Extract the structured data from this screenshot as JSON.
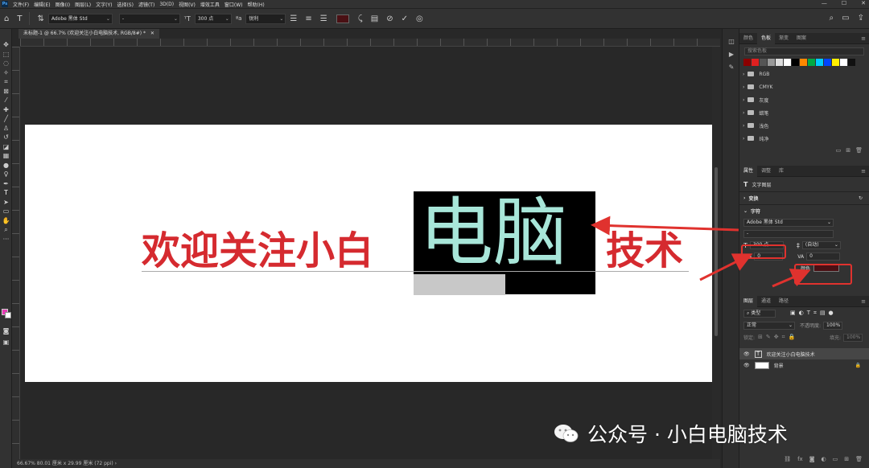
{
  "menubar": {
    "logo": "Ps",
    "items": [
      "文件(F)",
      "编辑(E)",
      "图像(I)",
      "图层(L)",
      "文字(Y)",
      "选择(S)",
      "滤镜(T)",
      "3D(D)",
      "视图(V)",
      "增效工具",
      "窗口(W)",
      "帮助(H)"
    ],
    "window_controls": [
      "—",
      "☐",
      "✕"
    ]
  },
  "options": {
    "font_family": "Adobe 黑体 Std",
    "font_style": "-",
    "font_size": "300 点",
    "anti_alias": "锐利",
    "text_color": "#4a1014"
  },
  "document": {
    "tab_title": "未标题-1 @ 66.7% (欢迎关注小白电脑技术, RGB/8#) *",
    "text_before": "欢迎关注小白",
    "text_selected": "电脑",
    "text_after": "技术",
    "text_color": "#d52a2f",
    "selected_text_color": "#a8e6d9"
  },
  "status": {
    "text": "66.67%  80.01 厘米 x 29.99 厘米 (72 ppi)  ›"
  },
  "swatches_panel": {
    "tabs": [
      "颜色",
      "色板",
      "渐变",
      "图案"
    ],
    "search_placeholder": "搜索色板",
    "colors": [
      "#8b0000",
      "#e02020",
      "#555555",
      "#999999",
      "#dddddd",
      "#ffffff",
      "#000000",
      "#ff8800",
      "#00aa44",
      "#00ccff",
      "#0044ff",
      "#ffee00",
      "#ffffff",
      "#111111"
    ],
    "groups": [
      "RGB",
      "CMYK",
      "灰度",
      "蜡笔",
      "浅色",
      "纯净"
    ]
  },
  "properties_panel": {
    "tabs": [
      "属性",
      "调整",
      "库"
    ],
    "layer_type": "文字图层",
    "section_transform": "变换",
    "section_character": "字符",
    "font_family": "Adobe 黑体 Std",
    "font_style": "-",
    "font_size": "300 点",
    "leading": "(自动)",
    "kerning": "0",
    "tracking": "0",
    "color_label": "颜色",
    "color_value": "#4a1014"
  },
  "layers_panel": {
    "tabs": [
      "图层",
      "通道",
      "路径"
    ],
    "search_placeholder": "类型",
    "blend_mode": "正常",
    "opacity_label": "不透明度:",
    "opacity_value": "100%",
    "lock_label": "锁定:",
    "fill_label": "填充:",
    "fill_value": "100%",
    "layers": [
      {
        "name": "欢迎关注小白电脑技术",
        "type": "text"
      },
      {
        "name": "背景",
        "type": "image"
      }
    ]
  },
  "watermark": {
    "text": "公众号 · 小白电脑技术"
  },
  "colors": {
    "accent_red": "#e0322e",
    "ui_bg": "#323232",
    "canvas_bg": "#282828"
  }
}
